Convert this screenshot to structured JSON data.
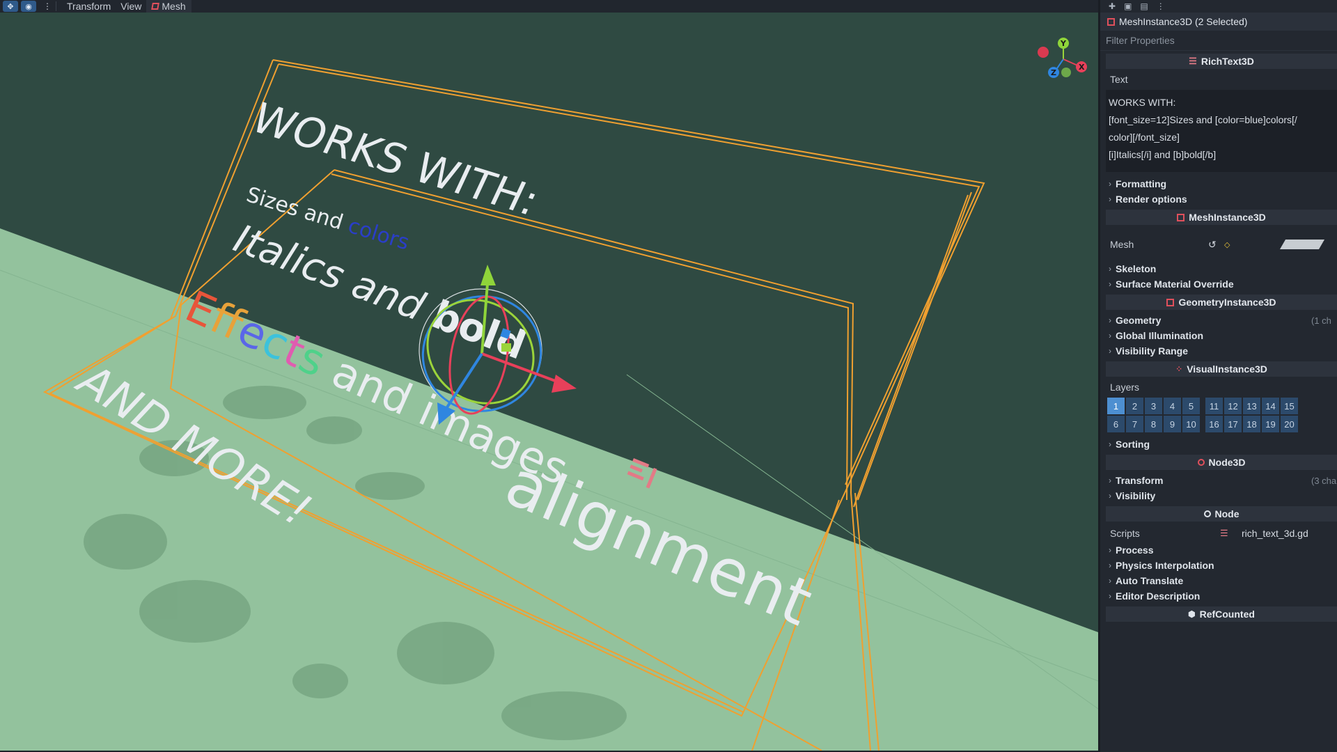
{
  "toolbar": {
    "menus": [
      "Transform",
      "View"
    ],
    "mesh_label": "Mesh"
  },
  "viewport": {
    "lines": [
      "WORKS WITH:",
      "Sizes and ",
      "colors",
      "Italics and ",
      "bold",
      "Effects",
      " and images",
      "AND MORE!",
      "alignment"
    ],
    "effects_colors": [
      "#e8553a",
      "#e8a23a",
      "#9c5bdc",
      "#5a66e8",
      "#3cc2dc",
      "#e05cb0",
      "#4fd18a"
    ],
    "gizmo_axes": [
      "X",
      "Y",
      "Z"
    ],
    "colors": {
      "wall": "#2f4a42",
      "floor": "#93c29d",
      "frame": "#f0a030",
      "colors_word": "#2a3ec8"
    }
  },
  "inspector": {
    "title": "MeshInstance3D (2 Selected)",
    "filter_placeholder": "Filter Properties",
    "richtext_section": "RichText3D",
    "text_label": "Text",
    "text_lines": [
      "WORKS WITH:",
      "[font_size=12]Sizes and [color=blue]colors[/",
      "color][/font_size]",
      "[i]Italics[/i] and [b]bold[/b]"
    ],
    "formatting": "Formatting",
    "render_options": "Render options",
    "meshinstance_section": "MeshInstance3D",
    "mesh_label": "Mesh",
    "skeleton": "Skeleton",
    "surface_override": "Surface Material Override",
    "geometry_section": "GeometryInstance3D",
    "geometry": "Geometry",
    "geometry_note": "(1 ch",
    "global_illum": "Global Illumination",
    "visibility_range": "Visibility Range",
    "visual_section": "VisualInstance3D",
    "layers_label": "Layers",
    "layers_row1": [
      "1",
      "2",
      "3",
      "4",
      "5",
      "11",
      "12",
      "13",
      "14",
      "15"
    ],
    "layers_row2": [
      "6",
      "7",
      "8",
      "9",
      "10",
      "16",
      "17",
      "18",
      "19",
      "20"
    ],
    "sorting": "Sorting",
    "node3d_section": "Node3D",
    "transform": "Transform",
    "transform_note": "(3 cha",
    "visibility": "Visibility",
    "node_section": "Node",
    "scripts_label": "Scripts",
    "script_file": "rich_text_3d.gd",
    "process": "Process",
    "physics_interp": "Physics Interpolation",
    "auto_translate": "Auto Translate",
    "editor_desc": "Editor Description",
    "refcounted_section": "RefCounted"
  }
}
